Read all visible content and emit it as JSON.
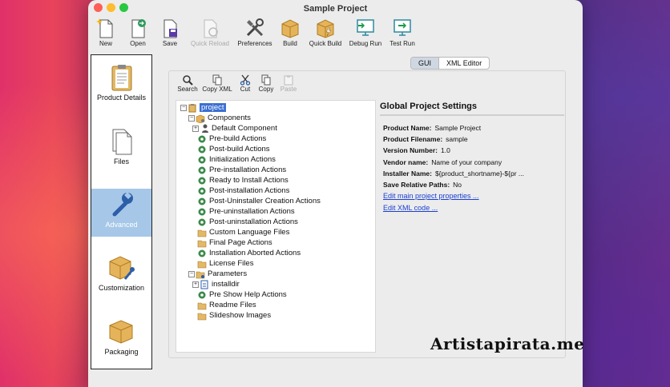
{
  "window": {
    "title": "Sample Project"
  },
  "toolbar": {
    "new": "New",
    "open": "Open",
    "save": "Save",
    "quick_reload": "Quick Reload",
    "preferences": "Preferences",
    "build": "Build",
    "quick_build": "Quick Build",
    "debug_run": "Debug Run",
    "test_run": "Test Run"
  },
  "sidebar": {
    "items": [
      {
        "label": "Product Details",
        "icon": "clipboard-icon"
      },
      {
        "label": "Files",
        "icon": "files-icon"
      },
      {
        "label": "Advanced",
        "icon": "wrench-icon",
        "selected": true
      },
      {
        "label": "Customization",
        "icon": "box-wrench-icon"
      },
      {
        "label": "Packaging",
        "icon": "box-icon"
      }
    ]
  },
  "tabs": {
    "gui": "GUI",
    "xml_editor": "XML Editor",
    "active": "GUI"
  },
  "subtoolbar": {
    "search": "Search",
    "copy_xml": "Copy XML",
    "cut": "Cut",
    "copy": "Copy",
    "paste": "Paste"
  },
  "tree": {
    "root": "project",
    "components": "Components",
    "default_component": "Default Component",
    "pre_build": "Pre-build Actions",
    "post_build": "Post-build Actions",
    "initialization": "Initialization Actions",
    "pre_installation": "Pre-installation Actions",
    "ready_to_install": "Ready to Install Actions",
    "post_installation": "Post-installation Actions",
    "post_uninstaller": "Post-Uninstaller Creation Actions",
    "pre_uninstallation": "Pre-uninstallation Actions",
    "post_uninstallation": "Post-uninstallation Actions",
    "custom_language": "Custom Language Files",
    "final_page": "Final Page Actions",
    "installation_aborted": "Installation Aborted Actions",
    "license_files": "License Files",
    "parameters": "Parameters",
    "installdir": "installdir",
    "pre_show_help": "Pre Show Help Actions",
    "readme_files": "Readme Files",
    "slideshow_images": "Slideshow Images"
  },
  "settings": {
    "title": "Global Project Settings",
    "product_name_label": "Product Name:",
    "product_name": "Sample Project",
    "product_filename_label": "Product Filename:",
    "product_filename": "sample",
    "version_label": "Version Number:",
    "version": "1.0",
    "vendor_label": "Vendor name:",
    "vendor": "Name of your company",
    "installer_name_label": "Installer Name:",
    "installer_name": "${product_shortname}-${pr ...",
    "save_relative_label": "Save Relative Paths:",
    "save_relative": "No",
    "link_edit_main": "Edit main project properties ...",
    "link_edit_xml": "Edit XML code ..."
  },
  "watermark": "Artistapirata.me",
  "colors": {
    "selection": "#3b6fd2",
    "sidebar_selected": "#a6c7e8",
    "link": "#1a3fd0"
  }
}
